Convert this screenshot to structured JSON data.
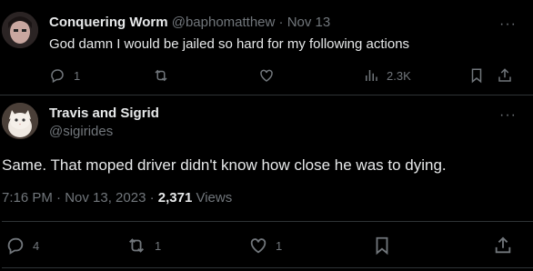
{
  "reply": {
    "name": "Conquering Worm",
    "handle": "@baphomatthew",
    "dot": "·",
    "date": "Nov 13",
    "text": "God damn I would be jailed so hard for my following actions",
    "replies": "1",
    "views": "2.3K",
    "more": "···"
  },
  "main": {
    "name": "Travis and Sigrid",
    "handle": "@sigirides",
    "text": "Same. That moped driver didn't know how close he was to dying.",
    "timestamp": "7:16 PM · Nov 13, 2023 · ",
    "views_count": "2,371",
    "views_label": " Views",
    "replies": "4",
    "retweets": "1",
    "likes": "1",
    "more": "···"
  },
  "icons": {
    "reply": "reply-icon",
    "retweet": "retweet-icon",
    "like": "heart-icon",
    "views": "views-chart-icon",
    "bookmark": "bookmark-icon",
    "share": "share-icon"
  },
  "colors": {
    "background": "#000000",
    "text": "#e7e9ea",
    "muted": "#71767b",
    "divider": "#2f3336"
  }
}
